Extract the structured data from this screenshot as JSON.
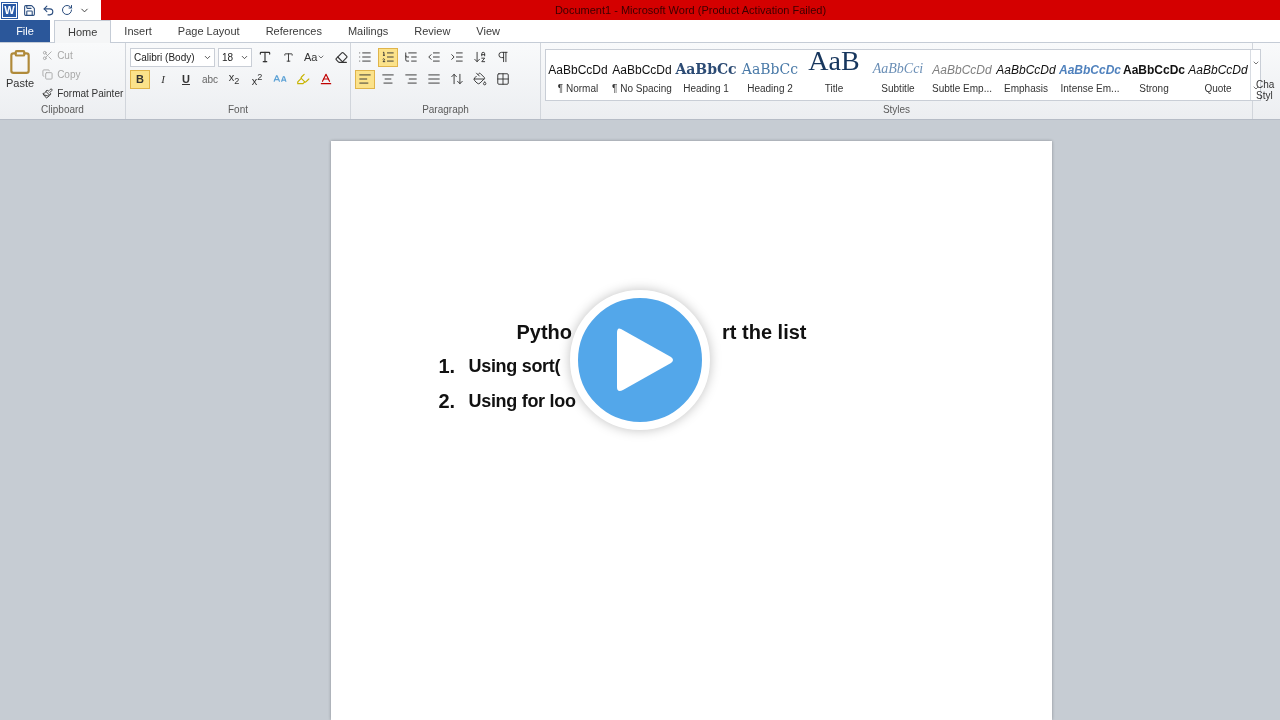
{
  "window": {
    "app_icon_letter": "W",
    "title": "Document1 - Microsoft Word (Product Activation Failed)"
  },
  "tabs": [
    {
      "label": "File",
      "kind": "file",
      "selected": false
    },
    {
      "label": "Home",
      "kind": "tab",
      "selected": true
    },
    {
      "label": "Insert",
      "kind": "tab",
      "selected": false
    },
    {
      "label": "Page Layout",
      "kind": "tab",
      "selected": false
    },
    {
      "label": "References",
      "kind": "tab",
      "selected": false
    },
    {
      "label": "Mailings",
      "kind": "tab",
      "selected": false
    },
    {
      "label": "Review",
      "kind": "tab",
      "selected": false
    },
    {
      "label": "View",
      "kind": "tab",
      "selected": false
    }
  ],
  "clipboard": {
    "label": "Clipboard",
    "paste": "Paste",
    "items": [
      {
        "label": "Cut",
        "kind": "cut",
        "disabled": true
      },
      {
        "label": "Copy",
        "kind": "copy",
        "disabled": true
      },
      {
        "label": "Format Painter",
        "kind": "painter",
        "disabled": false
      }
    ]
  },
  "font": {
    "label": "Font",
    "font_name": "Calibri (Body)",
    "font_size": "18",
    "case_button": "Aa",
    "format_buttons": [
      {
        "label": "B",
        "kind": "bold",
        "selected": true
      },
      {
        "label": "I",
        "kind": "italic",
        "selected": false
      },
      {
        "label": "U",
        "kind": "underline",
        "selected": false
      },
      {
        "label": "abc",
        "kind": "strike",
        "selected": false
      },
      {
        "label": "x$_{2}$",
        "kind": "sub",
        "selected": false
      },
      {
        "label": "x$^{2}$",
        "kind": "sup",
        "selected": false
      }
    ]
  },
  "paragraph": {
    "label": "Paragraph",
    "row_1": [
      {
        "kind": "bullets",
        "selected": false
      },
      {
        "kind": "numbering",
        "selected": true
      },
      {
        "kind": "multilevel",
        "selected": false
      },
      {
        "kind": "outdent",
        "selected": false
      },
      {
        "kind": "indent",
        "selected": false
      },
      {
        "kind": "sort",
        "selected": false
      },
      {
        "kind": "pilcrow",
        "selected": false
      }
    ],
    "row_2": [
      {
        "kind": "align_left",
        "selected": true
      },
      {
        "kind": "align_center",
        "selected": false
      },
      {
        "kind": "align_right",
        "selected": false
      },
      {
        "kind": "justify",
        "selected": false
      },
      {
        "kind": "spacing",
        "selected": false
      },
      {
        "kind": "shading",
        "selected": false
      },
      {
        "kind": "borders",
        "selected": false
      }
    ]
  },
  "styles": {
    "label": "Styles",
    "items": [
      {
        "preview": "AaBbCcDd",
        "name": "¶ Normal",
        "kind": "normal"
      },
      {
        "preview": "AaBbCcDd",
        "name": "¶ No Spacing",
        "kind": "normal"
      },
      {
        "preview": "AaBbCc",
        "name": "Heading 1",
        "kind": "heading1"
      },
      {
        "preview": "AaBbCc",
        "name": "Heading 2",
        "kind": "heading2"
      },
      {
        "preview": "AaB",
        "name": "Title",
        "kind": "title"
      },
      {
        "preview": "AaBbCci",
        "name": "Subtitle",
        "kind": "subtitle"
      },
      {
        "preview": "AaBbCcDd",
        "name": "Subtle Emp...",
        "kind": "subtle"
      },
      {
        "preview": "AaBbCcDd",
        "name": "Emphasis",
        "kind": "emphasis"
      },
      {
        "preview": "AaBbCcDc",
        "name": "Intense Em...",
        "kind": "intense"
      },
      {
        "preview": "AaBbCcDc",
        "name": "Strong",
        "kind": "strong"
      },
      {
        "preview": "AaBbCcDd",
        "name": "Quote",
        "kind": "emphasis"
      }
    ],
    "change_styles": [
      "Cha",
      "Styl"
    ]
  },
  "document": {
    "heading_parts": [
      "Pytho",
      "rt the list"
    ],
    "list": [
      {
        "number": "1.",
        "text": "Using sort("
      },
      {
        "number": "2.",
        "text": "Using for loo"
      }
    ]
  },
  "video_overlay": {
    "kind": "play"
  }
}
